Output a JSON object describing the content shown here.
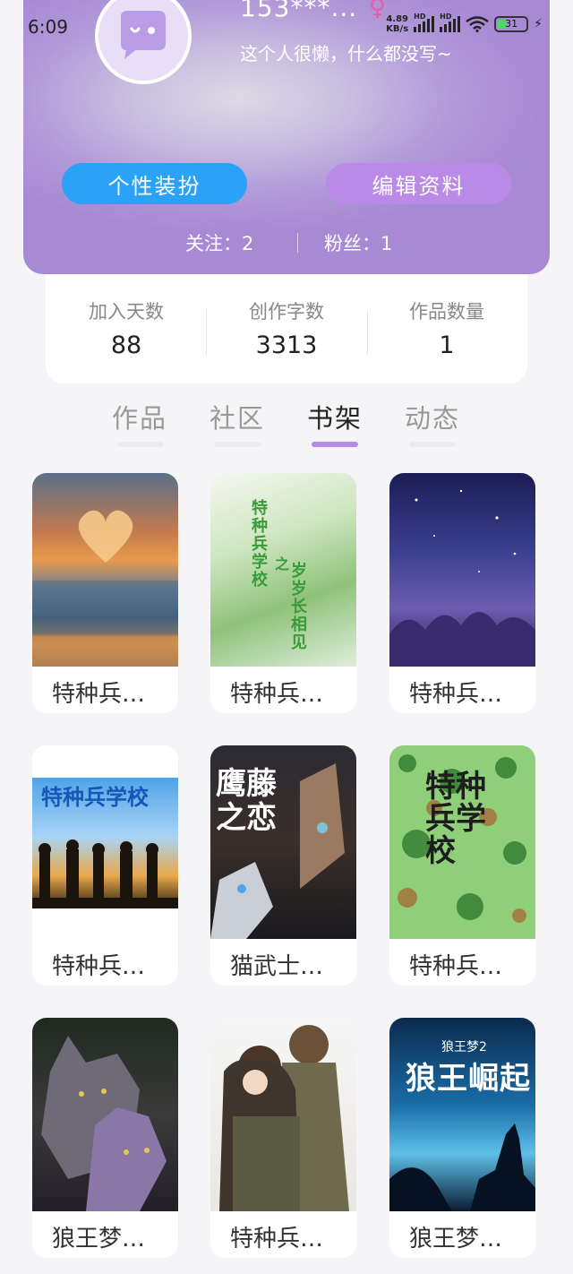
{
  "status_bar": {
    "time": "6:09",
    "net_speed": "4.89",
    "net_unit": "KB/s",
    "sig_label": "HD",
    "battery": "31",
    "icons": [
      "hd-signal-icon",
      "signal-icon",
      "wifi-icon",
      "battery-icon",
      "charging-icon"
    ]
  },
  "profile": {
    "username": "153***...",
    "gender_icon": "female-symbol-icon",
    "gender_symbol": "♀",
    "bio": "这个人很懒，什么都没写~",
    "dress_button": "个性装扮",
    "edit_button": "编辑资料",
    "following_label": "关注：2",
    "fans_label": "粉丝：1"
  },
  "stats": [
    {
      "label": "加入天数",
      "value": "88"
    },
    {
      "label": "创作字数",
      "value": "3313"
    },
    {
      "label": "作品数量",
      "value": "1"
    }
  ],
  "tabs": [
    {
      "label": "作品",
      "active": false
    },
    {
      "label": "社区",
      "active": false
    },
    {
      "label": "书架",
      "active": true
    },
    {
      "label": "动态",
      "active": false
    }
  ],
  "books": [
    {
      "title": "特种兵…"
    },
    {
      "title": "特种兵…"
    },
    {
      "title": "特种兵…"
    },
    {
      "title": "特种兵…"
    },
    {
      "title": "猫武士…"
    },
    {
      "title": "特种兵…"
    },
    {
      "title": "狼王梦…"
    },
    {
      "title": "特种兵…"
    },
    {
      "title": "狼王梦…"
    }
  ],
  "cover_text": {
    "b2_line1": "特种兵学校",
    "b2_line2": "之",
    "b2_line3": "岁岁长相见",
    "b4_banner": "特种兵学校",
    "b5_title": "鹰藤之恋",
    "b6_title": "特种兵学校",
    "b9_small": "狼王梦2",
    "b9_title": "狼王崛起"
  },
  "colors": {
    "accent_purple": "#b98ae6",
    "accent_blue": "#2aa2f8"
  }
}
